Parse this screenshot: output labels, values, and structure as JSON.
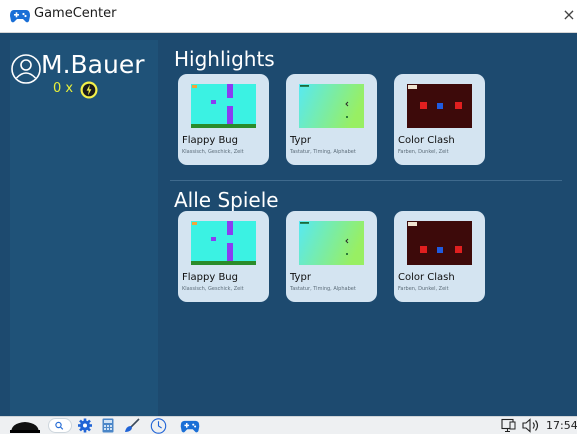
{
  "window": {
    "title": "GameCenter",
    "app_icon": "gamepad-icon",
    "close_icon": "close-icon"
  },
  "user": {
    "name": "M.Bauer",
    "avatar_icon": "user-avatar-icon",
    "coins": "0 x",
    "coin_icon": "coin-icon"
  },
  "sections": [
    {
      "title": "Highlights",
      "games": [
        {
          "title": "Flappy Bug",
          "tags": "Klassisch, Geschick, Zeit",
          "thumbnail": "flappy-bug-thumbnail"
        },
        {
          "title": "Typr",
          "tags": "Tastatur, Timing, Alphabet",
          "thumbnail": "typr-thumbnail"
        },
        {
          "title": "Color Clash",
          "tags": "Farben, Dunkel, Zeit",
          "thumbnail": "color-clash-thumbnail"
        }
      ]
    },
    {
      "title": "Alle Spiele",
      "games": [
        {
          "title": "Flappy Bug",
          "tags": "Klassisch, Geschick, Zeit",
          "thumbnail": "flappy-bug-thumbnail"
        },
        {
          "title": "Typr",
          "tags": "Tastatur, Timing, Alphabet",
          "thumbnail": "typr-thumbnail"
        },
        {
          "title": "Color Clash",
          "tags": "Farben, Dunkel, Zeit",
          "thumbnail": "color-clash-thumbnail"
        }
      ]
    }
  ],
  "taskbar": {
    "items": [
      "hat-icon",
      "search-icon",
      "gear-icon",
      "calculator-icon",
      "brush-icon",
      "clock-icon",
      "gamepad-icon"
    ],
    "tray": [
      "network-icon",
      "volume-icon"
    ],
    "clock": "17:54"
  },
  "colors": {
    "background": "#1d4a6f",
    "sidebar": "#1f5278",
    "card": "#d4e4f1",
    "coins": "#e8ef3a"
  }
}
